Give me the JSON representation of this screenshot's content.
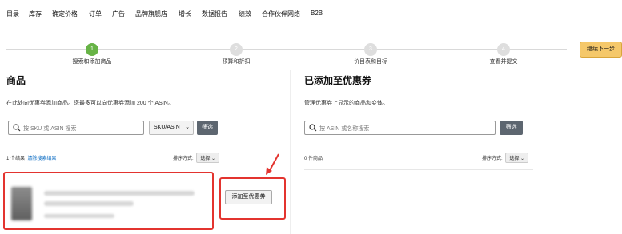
{
  "nav": {
    "items": [
      "目录",
      "库存",
      "确定价格",
      "订单",
      "广告",
      "品牌旗舰店",
      "增长",
      "数据报告",
      "绩效",
      "合作伙伴网络",
      "B2B"
    ]
  },
  "stepper": {
    "steps": [
      {
        "number": "1",
        "label": "搜索和添加商品",
        "active": true
      },
      {
        "number": "2",
        "label": "预算和折扣",
        "active": false
      },
      {
        "number": "3",
        "label": "价目表和目标",
        "active": false
      },
      {
        "number": "4",
        "label": "查看并提交",
        "active": false
      }
    ],
    "continue_label": "继续下一步"
  },
  "left": {
    "title": "商品",
    "description": "在此处向优惠券添加商品。您最多可以向优惠券添加 200 个 ASIN。",
    "search_placeholder": "按 SKU 或 ASIN 搜索",
    "select_value": "SKU/ASIN",
    "filter_label": "筛选",
    "result_count": "1 个结果",
    "clear_link": "清除搜索结果",
    "sort_label": "排序方式:",
    "sort_value": "选择",
    "add_button": "添加至优惠券"
  },
  "right": {
    "title": "已添加至优惠券",
    "description": "管理优惠券上显示的商品和变体。",
    "search_placeholder": "按 ASIN 或名称搜索",
    "filter_label": "筛选",
    "count": "0 件商品",
    "sort_label": "排序方式:",
    "sort_value": "选择"
  },
  "colors": {
    "active_step": "#67b346",
    "highlight": "#e3342f",
    "primary_button": "#f5c86a",
    "filter_button": "#5d6670"
  }
}
